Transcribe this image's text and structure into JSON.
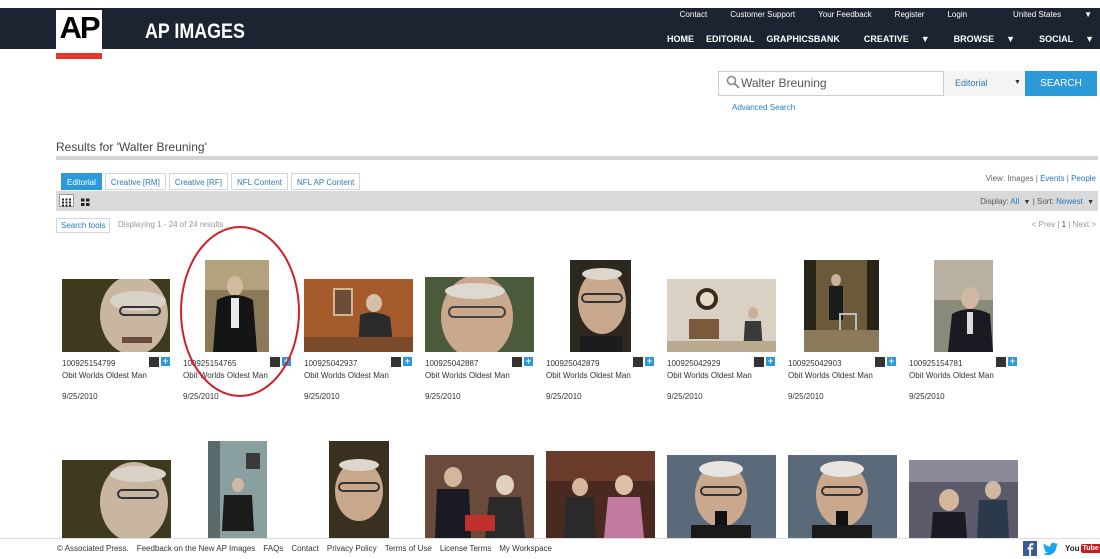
{
  "brand": {
    "logo_text": "AP",
    "name": "AP IMAGES"
  },
  "util_links": [
    "Contact",
    "Customer Support",
    "Your Feedback",
    "Register",
    "Login",
    "United States"
  ],
  "main_nav": [
    "HOME",
    "EDITORIAL",
    "GRAPHICSBANK",
    "CREATIVE",
    "BROWSE",
    "SOCIAL"
  ],
  "search": {
    "value": "Walter Breuning",
    "category": "Editorial",
    "button": "SEARCH",
    "advanced": "Advanced Search"
  },
  "results": {
    "title": "Results for 'Walter Breuning'"
  },
  "tabs": [
    "Editorial",
    "Creative [RM]",
    "Creative [RF]",
    "NFL Content",
    "NFL AP Content"
  ],
  "view": {
    "label": "View:",
    "images": "Images",
    "sep1": "|",
    "events": "Events",
    "sep2": "|",
    "people": "People"
  },
  "display": {
    "label": "Display:",
    "value": "All",
    "sort_label": "Sort:",
    "sort_value": "Newest"
  },
  "search_tools": "Search tools",
  "displaying": "Displaying 1 - 24  of  24 results",
  "pager": {
    "prev": "< Prev",
    "page": "1",
    "next": "Next >"
  },
  "row1": [
    {
      "id": "100925154799",
      "title": "Obit Worlds Oldest Man",
      "date": "9/25/2010"
    },
    {
      "id": "100925154765",
      "title": "Obit Worlds Oldest Man",
      "date": "9/25/2010"
    },
    {
      "id": "100925042937",
      "title": "Obit Worlds Oldest Man",
      "date": "9/25/2010"
    },
    {
      "id": "100925042887",
      "title": "Obit Worlds Oldest Man",
      "date": "9/25/2010"
    },
    {
      "id": "100925042879",
      "title": "Obit Worlds Oldest Man",
      "date": "9/25/2010"
    },
    {
      "id": "100925042929",
      "title": "Obit Worlds Oldest Man",
      "date": "9/25/2010"
    },
    {
      "id": "100925042903",
      "title": "Obit Worlds Oldest Man",
      "date": "9/25/2010"
    },
    {
      "id": "100925154781",
      "title": "Obit Worlds Oldest Man",
      "date": "9/25/2010"
    }
  ],
  "footer": [
    "© Associated Press.",
    "Feedback on the New AP Images",
    "FAQs",
    "Contact",
    "Privacy Policy",
    "Terms of Use",
    "License Terms",
    "My Workspace"
  ],
  "social": {
    "youtube": "You"
  }
}
